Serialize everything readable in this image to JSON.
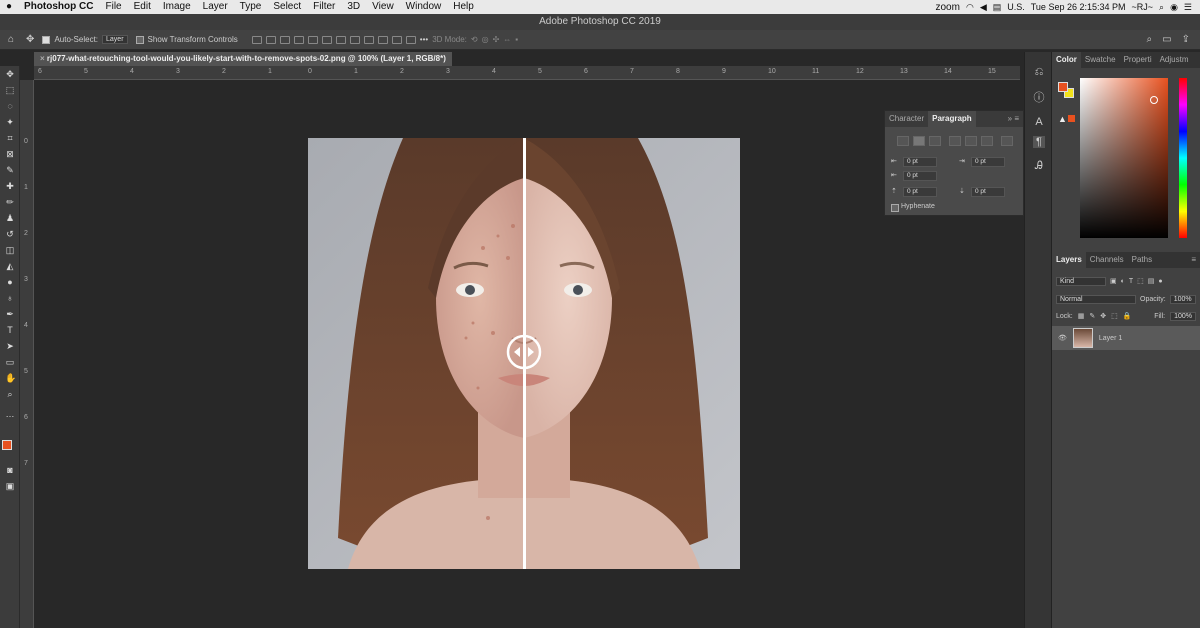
{
  "menubar": {
    "apple": "",
    "app_name": "Photoshop CC",
    "items": [
      "File",
      "Edit",
      "Image",
      "Layer",
      "Type",
      "Select",
      "Filter",
      "3D",
      "View",
      "Window",
      "Help"
    ],
    "status": {
      "zoom": "zoom",
      "locale": "U.S.",
      "datetime": "Tue Sep 26  2:15:34 PM",
      "user": "~RJ~"
    }
  },
  "window": {
    "title": "Adobe Photoshop CC 2019"
  },
  "options_bar": {
    "auto_select_label": "Auto-Select:",
    "auto_select_value": "Layer",
    "show_transform_label": "Show Transform Controls",
    "mode_3d_label": "3D Mode:"
  },
  "document": {
    "tab_title": "rj077-what-retouching-tool-would-you-likely-start-with-to-remove-spots-02.png @ 100% (Layer 1, RGB/8*)",
    "hruler_ticks": [
      "6",
      "5",
      "4",
      "3",
      "2",
      "1",
      "0",
      "1",
      "2",
      "3",
      "4",
      "5",
      "6",
      "7",
      "8",
      "9",
      "10",
      "11",
      "12",
      "13",
      "14",
      "15"
    ],
    "vruler_ticks": [
      "0",
      "1",
      "2",
      "3",
      "4",
      "5",
      "6",
      "7"
    ]
  },
  "paragraph_panel": {
    "tabs": [
      "Character",
      "Paragraph"
    ],
    "active_tab": "Paragraph",
    "indent_left": "0 pt",
    "indent_right": "0 pt",
    "indent_first": "0 pt",
    "space_before": "0 pt",
    "space_after": "0 pt",
    "hyphenate_label": "Hyphenate"
  },
  "color_panel": {
    "tabs": [
      "Color",
      "Swatche",
      "Properti",
      "Adjustm"
    ],
    "active_tab": "Color",
    "foreground": "#e8511f",
    "background": "#f2e21a"
  },
  "layers_panel": {
    "tabs": [
      "Layers",
      "Channels",
      "Paths"
    ],
    "active_tab": "Layers",
    "kind_label": "Kind",
    "blend_mode": "Normal",
    "opacity_label": "Opacity:",
    "opacity_value": "100%",
    "lock_label": "Lock:",
    "fill_label": "Fill:",
    "fill_value": "100%",
    "layers": [
      {
        "name": "Layer 1",
        "visible": true
      }
    ]
  },
  "colors": {
    "accent_fg": "#e8511f",
    "accent_bg": "#f2e21a"
  }
}
